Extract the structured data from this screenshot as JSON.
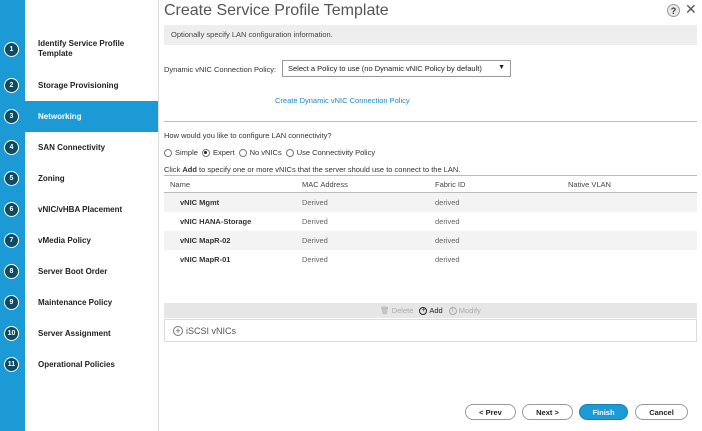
{
  "window": {
    "title": "Create Service Profile Template"
  },
  "steps": [
    {
      "num": "1",
      "label": "Identify Service Profile Template"
    },
    {
      "num": "2",
      "label": "Storage Provisioning"
    },
    {
      "num": "3",
      "label": "Networking"
    },
    {
      "num": "4",
      "label": "SAN Connectivity"
    },
    {
      "num": "5",
      "label": "Zoning"
    },
    {
      "num": "6",
      "label": "vNIC/vHBA Placement"
    },
    {
      "num": "7",
      "label": "vMedia Policy"
    },
    {
      "num": "8",
      "label": "Server Boot Order"
    },
    {
      "num": "9",
      "label": "Maintenance Policy"
    },
    {
      "num": "10",
      "label": "Server Assignment"
    },
    {
      "num": "11",
      "label": "Operational Policies"
    }
  ],
  "active_step": 3,
  "info": "Optionally specify LAN configuration information.",
  "dynamic_vnic": {
    "label": "Dynamic vNIC Connection Policy:",
    "selected": "Select a Policy to use (no Dynamic vNIC Policy by default)",
    "create_link": "Create Dynamic vNIC Connection Policy"
  },
  "lan": {
    "question": "How would you like to configure LAN connectivity?",
    "options": [
      "Simple",
      "Expert",
      "No vNICs",
      "Use Connectivity Policy"
    ],
    "selected": "Expert",
    "hint_pre": "Click ",
    "hint_bold": "Add",
    "hint_post": " to specify one or more vNICs that the server should use to connect to the LAN."
  },
  "table": {
    "headers": [
      "Name",
      "MAC Address",
      "Fabric ID",
      "Native VLAN"
    ],
    "rows": [
      {
        "name": "vNIC Mgmt",
        "mac": "Derived",
        "fabric": "derived"
      },
      {
        "name": "vNIC HANA-Storage",
        "mac": "Derived",
        "fabric": "derived"
      },
      {
        "name": "vNIC MapR-02",
        "mac": "Derived",
        "fabric": "derived"
      },
      {
        "name": "vNIC MapR-01",
        "mac": "Derived",
        "fabric": "derived"
      }
    ],
    "actions": {
      "delete": "Delete",
      "add": "Add",
      "modify": "Modify"
    }
  },
  "iscsi": {
    "label": "iSCSI vNICs"
  },
  "buttons": {
    "prev": "< Prev",
    "next": "Next >",
    "finish": "Finish",
    "cancel": "Cancel"
  },
  "colors": {
    "accent": "#1b9ad6",
    "step_circle": "#0d4a63"
  },
  "icons": {
    "help": "help-icon",
    "close": "close-icon"
  }
}
